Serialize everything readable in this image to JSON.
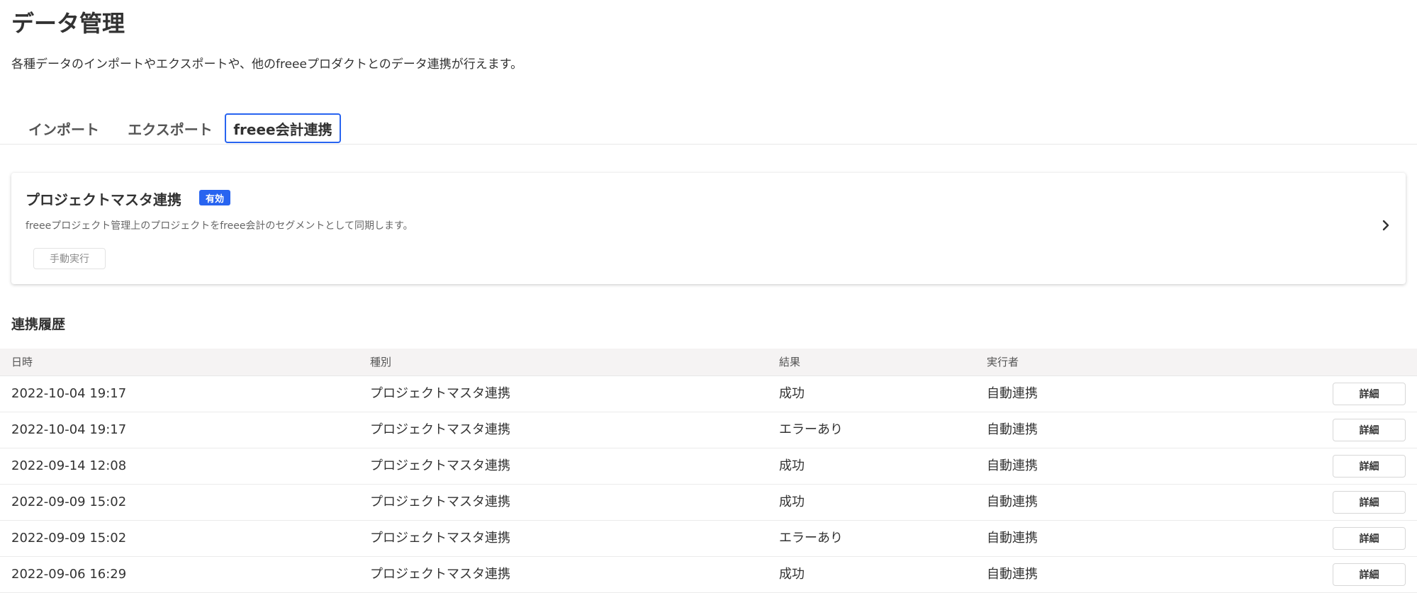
{
  "page": {
    "title": "データ管理",
    "description": "各種データのインポートやエクスポートや、他のfreeeプロダクトとのデータ連携が行えます。"
  },
  "tabs": [
    {
      "label": "インポート",
      "active": false
    },
    {
      "label": "エクスポート",
      "active": false
    },
    {
      "label": "freee会計連携",
      "active": true
    }
  ],
  "card": {
    "title": "プロジェクトマスタ連携",
    "badge": "有効",
    "description": "freeeプロジェクト管理上のプロジェクトをfreee会計のセグメントとして同期します。",
    "manual_button": "手動実行",
    "chevron_icon": "chevron-right-icon"
  },
  "history": {
    "title": "連携履歴",
    "columns": [
      "日時",
      "種別",
      "結果",
      "実行者"
    ],
    "detail_label": "詳細",
    "rows": [
      {
        "datetime": "2022-10-04 19:17",
        "type": "プロジェクトマスタ連携",
        "result": "成功",
        "executor": "自動連携"
      },
      {
        "datetime": "2022-10-04 19:17",
        "type": "プロジェクトマスタ連携",
        "result": "エラーあり",
        "executor": "自動連携"
      },
      {
        "datetime": "2022-09-14 12:08",
        "type": "プロジェクトマスタ連携",
        "result": "成功",
        "executor": "自動連携"
      },
      {
        "datetime": "2022-09-09 15:02",
        "type": "プロジェクトマスタ連携",
        "result": "成功",
        "executor": "自動連携"
      },
      {
        "datetime": "2022-09-09 15:02",
        "type": "プロジェクトマスタ連携",
        "result": "エラーあり",
        "executor": "自動連携"
      },
      {
        "datetime": "2022-09-06 16:29",
        "type": "プロジェクトマスタ連携",
        "result": "成功",
        "executor": "自動連携"
      }
    ]
  },
  "colors": {
    "accent": "#2864f0",
    "text": "#323232",
    "header_bg": "#f5f3f3"
  }
}
